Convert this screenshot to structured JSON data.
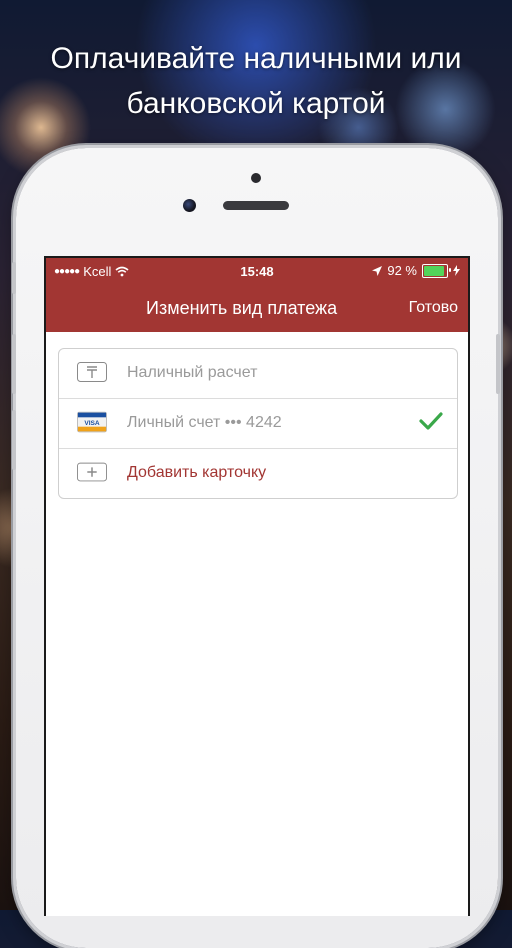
{
  "hero": {
    "line1": "Оплачивайте наличными или",
    "line2": "банковской картой"
  },
  "status_bar": {
    "carrier": "Kcell",
    "time": "15:48",
    "battery": "92 %",
    "battery_level": 0.92
  },
  "nav": {
    "title": "Изменить вид платежа",
    "done_label": "Готово"
  },
  "payment_methods": [
    {
      "label": "Наличный расчет",
      "icon": "tenge-icon",
      "selected": false
    },
    {
      "label": "Личный счет ••• 4242",
      "icon": "visa-card-icon",
      "selected": true
    },
    {
      "label": "Добавить карточку",
      "icon": "plus-icon",
      "selected": false
    }
  ],
  "colors": {
    "accent": "#a23633",
    "check": "#3aa84a",
    "battery": "#52d45a"
  }
}
